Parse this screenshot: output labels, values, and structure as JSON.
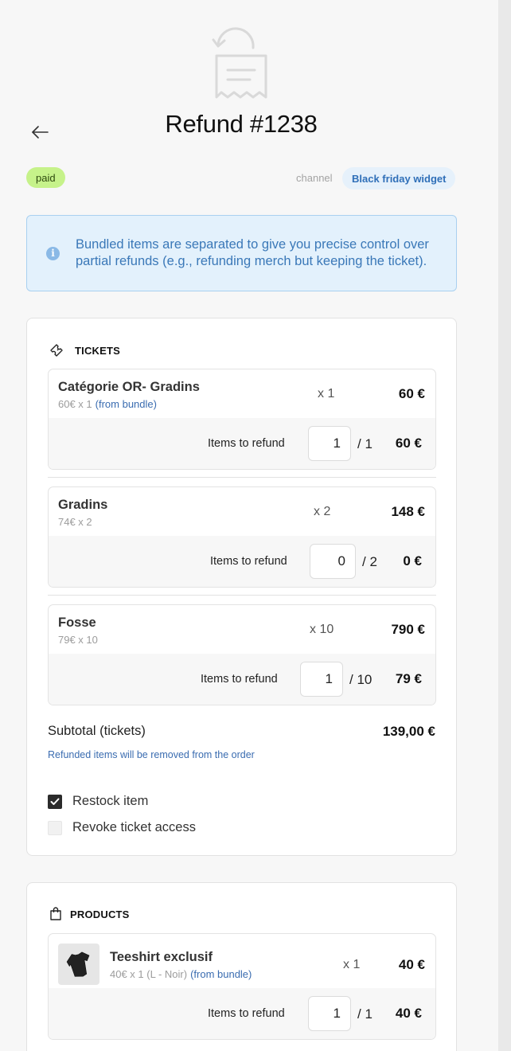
{
  "header": {
    "title": "Refund #1238",
    "status": "paid",
    "channel_label": "channel",
    "channel_value": "Black friday widget"
  },
  "info_banner": {
    "text": "Bundled items are separated to give you precise control over partial refunds (e.g., refunding merch but keeping the ticket)."
  },
  "tickets": {
    "section_title": "TICKETS",
    "items": [
      {
        "name": "Catégorie OR- Gradins",
        "unit_line": "60€ x 1",
        "bundle_note": "(from bundle)",
        "qty": "x 1",
        "total": "60 €",
        "refund_label": "Items to refund",
        "refund_value": "1",
        "refund_max": "/ 1",
        "refund_total": "60 €"
      },
      {
        "name": "Gradins",
        "unit_line": "74€ x 2",
        "bundle_note": "",
        "qty": "x 2",
        "total": "148 €",
        "refund_label": "Items to refund",
        "refund_value": "0",
        "refund_max": "/ 2",
        "refund_total": "0 €"
      },
      {
        "name": "Fosse",
        "unit_line": "79€ x 10",
        "bundle_note": "",
        "qty": "x 10",
        "total": "790 €",
        "refund_label": "Items to refund",
        "refund_value": "1",
        "refund_max": "/ 10",
        "refund_total": "79 €"
      }
    ],
    "subtotal_label": "Subtotal (tickets)",
    "subtotal_value": "139,00 €",
    "subtotal_note": "Refunded items will be removed from the order",
    "restock_label": "Restock item",
    "restock_checked": true,
    "revoke_label": "Revoke ticket access",
    "revoke_checked": false
  },
  "products": {
    "section_title": "PRODUCTS",
    "items": [
      {
        "name": "Teeshirt exclusif",
        "unit_line": "40€ x 1 (L - Noir)",
        "bundle_note": "(from bundle)",
        "qty": "x 1",
        "total": "40 €",
        "refund_label": "Items to refund",
        "refund_value": "1",
        "refund_max": "/ 1",
        "refund_total": "40 €"
      }
    ]
  },
  "colors": {
    "status_bg": "#c6f28a",
    "channel_bg": "#e6f1fb",
    "channel_text": "#2f6fb8",
    "banner_bg": "#e3f1fc",
    "link": "#3a6cb0"
  },
  "icons": {
    "hero": "receipt-refund-icon",
    "back": "arrow-left-icon",
    "info": "info-icon",
    "tickets": "ticket-icon",
    "products": "shopping-bag-icon",
    "check": "checkmark-icon"
  }
}
